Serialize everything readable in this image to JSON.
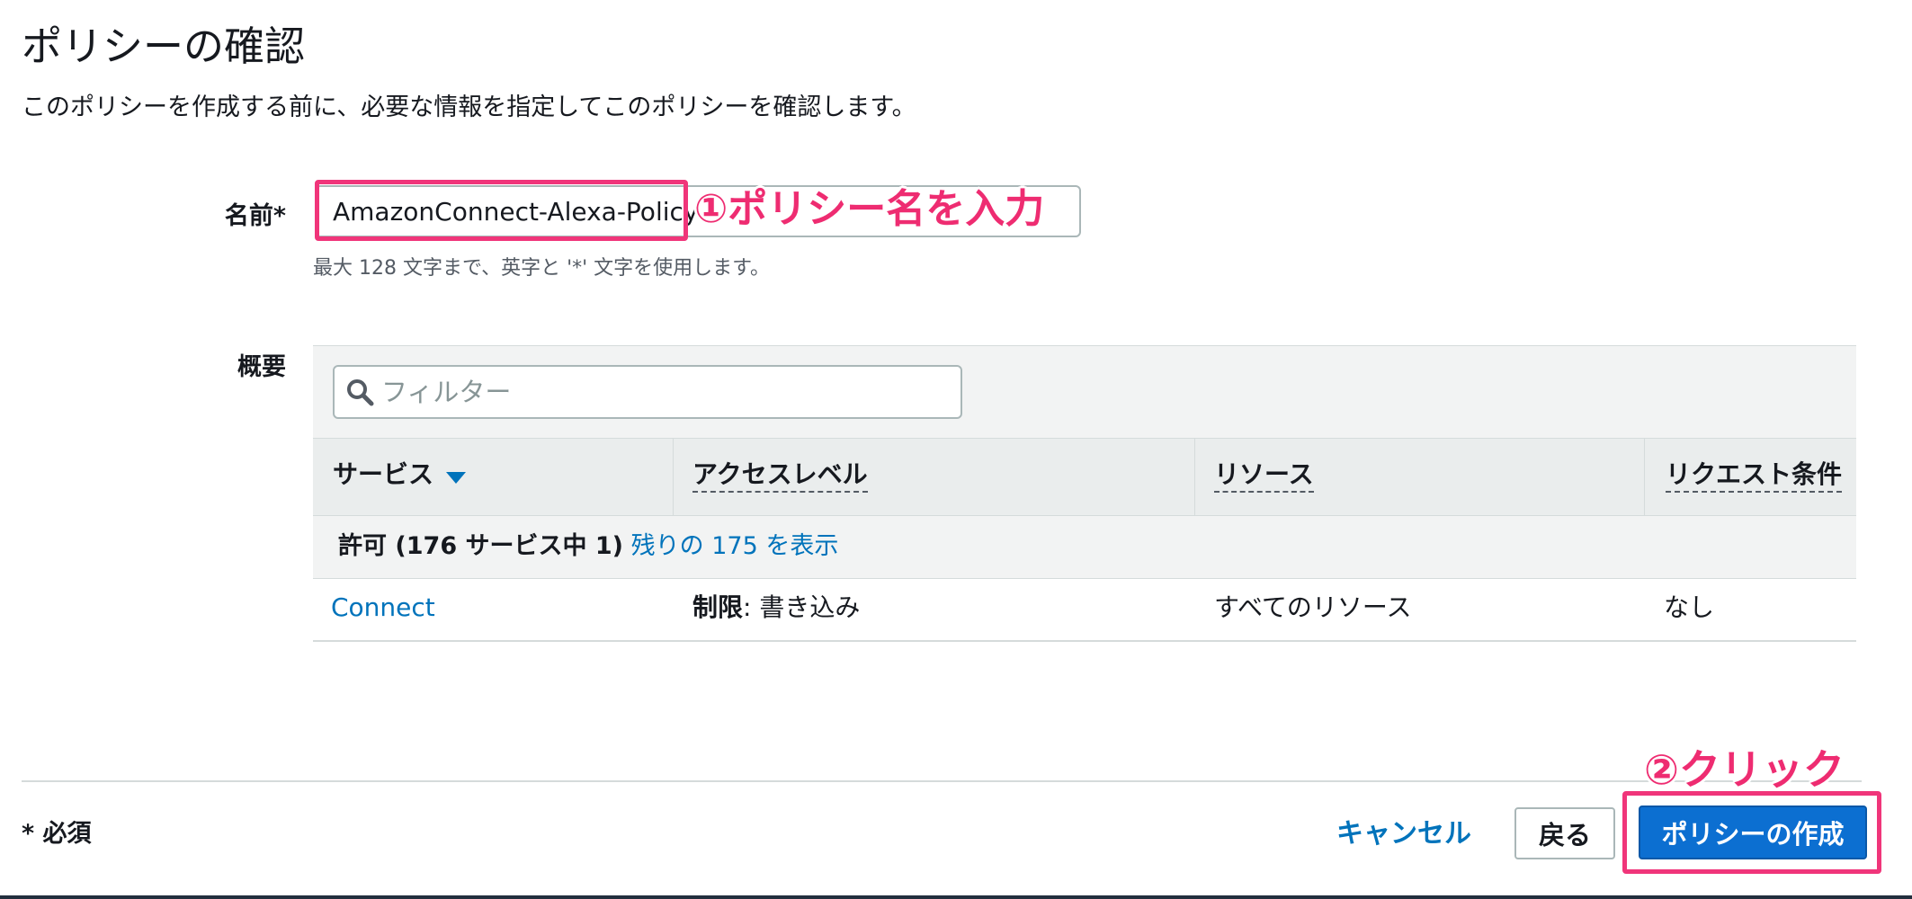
{
  "page": {
    "title": "ポリシーの確認",
    "description": "このポリシーを作成する前に、必要な情報を指定してこのポリシーを確認します。"
  },
  "name_field": {
    "label": "名前*",
    "value": "AmazonConnect-Alexa-Policy",
    "hint": "最大 128 文字まで、英字と '*' 文字を使用します。"
  },
  "annotations": {
    "step1": "①ポリシー名を入力",
    "step2": "②クリック",
    "highlight_color": "#f0357a"
  },
  "summary": {
    "label": "概要",
    "filter_placeholder": "フィルター",
    "columns": [
      "サービス",
      "アクセスレベル",
      "リソース",
      "リクエスト条件"
    ],
    "sort_icon": "caret-down-icon",
    "group": {
      "prefix": "許可 (176 サービス中 1)",
      "link": "残りの 175 を表示"
    },
    "rows": [
      {
        "service": "Connect",
        "access_level_label": "制限",
        "access_level_value": ": 書き込み",
        "resource": "すべてのリソース",
        "condition": "なし"
      }
    ]
  },
  "footer": {
    "required_note": "* 必須",
    "cancel_label": "キャンセル",
    "back_label": "戻る",
    "create_label": "ポリシーの作成"
  },
  "colors": {
    "link": "#0073bb",
    "primary_button": "#0c6fd1"
  }
}
